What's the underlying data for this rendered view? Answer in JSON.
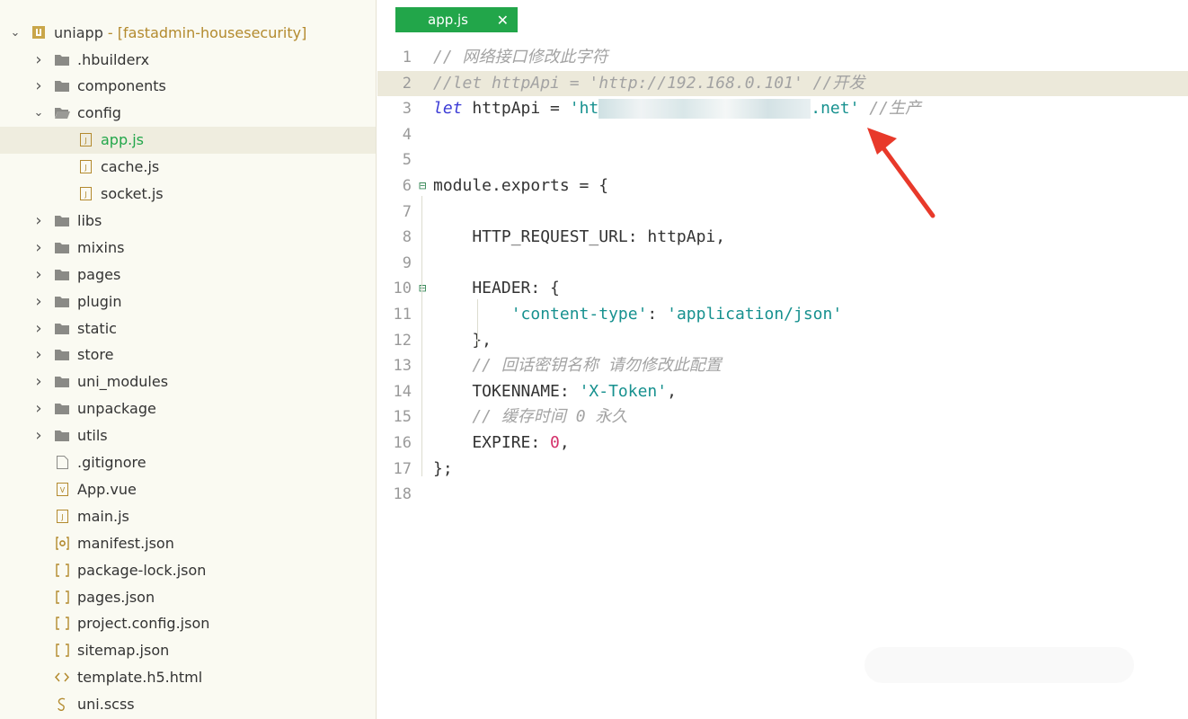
{
  "sidebar": {
    "project": {
      "name": "uniapp",
      "suffix": " - [fastadmin-housesecurity]"
    },
    "items": [
      {
        "label": ".hbuilderx",
        "type": "folder",
        "indent": 1,
        "expanded": false
      },
      {
        "label": "components",
        "type": "folder",
        "indent": 1,
        "expanded": false
      },
      {
        "label": "config",
        "type": "folder-open",
        "indent": 1,
        "expanded": true
      },
      {
        "label": "app.js",
        "type": "js",
        "indent": 2,
        "selected": true
      },
      {
        "label": "cache.js",
        "type": "js",
        "indent": 2
      },
      {
        "label": "socket.js",
        "type": "js",
        "indent": 2
      },
      {
        "label": "libs",
        "type": "folder",
        "indent": 1,
        "expanded": false
      },
      {
        "label": "mixins",
        "type": "folder",
        "indent": 1,
        "expanded": false
      },
      {
        "label": "pages",
        "type": "folder",
        "indent": 1,
        "expanded": false
      },
      {
        "label": "plugin",
        "type": "folder",
        "indent": 1,
        "expanded": false
      },
      {
        "label": "static",
        "type": "folder",
        "indent": 1,
        "expanded": false
      },
      {
        "label": "store",
        "type": "folder",
        "indent": 1,
        "expanded": false
      },
      {
        "label": "uni_modules",
        "type": "folder",
        "indent": 1,
        "expanded": false
      },
      {
        "label": "unpackage",
        "type": "folder",
        "indent": 1,
        "expanded": false
      },
      {
        "label": "utils",
        "type": "folder",
        "indent": 1,
        "expanded": false
      },
      {
        "label": ".gitignore",
        "type": "file",
        "indent": 1
      },
      {
        "label": "App.vue",
        "type": "vue",
        "indent": 1
      },
      {
        "label": "main.js",
        "type": "js",
        "indent": 1
      },
      {
        "label": "manifest.json",
        "type": "manifest",
        "indent": 1
      },
      {
        "label": "package-lock.json",
        "type": "json",
        "indent": 1
      },
      {
        "label": "pages.json",
        "type": "json",
        "indent": 1
      },
      {
        "label": "project.config.json",
        "type": "json",
        "indent": 1
      },
      {
        "label": "sitemap.json",
        "type": "json",
        "indent": 1
      },
      {
        "label": "template.h5.html",
        "type": "html",
        "indent": 1
      },
      {
        "label": "uni.scss",
        "type": "scss",
        "indent": 1
      }
    ]
  },
  "editor": {
    "tab": {
      "label": "app.js",
      "close": "✕"
    },
    "lines": [
      {
        "n": "1",
        "parts": [
          {
            "c": "cm",
            "t": "// 网络接口修改此字符"
          }
        ]
      },
      {
        "n": "2",
        "hl": true,
        "parts": [
          {
            "c": "cm",
            "t": "//let httpApi = 'http://192.168.0.101' //开发"
          }
        ]
      },
      {
        "n": "3",
        "parts": [
          {
            "c": "kw",
            "t": "let"
          },
          {
            "c": "",
            "t": " httpApi = "
          },
          {
            "c": "str",
            "t": "'ht"
          },
          {
            "c": "blur",
            "t": ""
          },
          {
            "c": "str",
            "t": ".net'"
          },
          {
            "c": "cm",
            "t": " //生产"
          }
        ]
      },
      {
        "n": "4",
        "parts": []
      },
      {
        "n": "5",
        "parts": []
      },
      {
        "n": "6",
        "fold": "⊟",
        "parts": [
          {
            "c": "",
            "t": "module.exports = {"
          }
        ]
      },
      {
        "n": "7",
        "parts": []
      },
      {
        "n": "8",
        "parts": [
          {
            "c": "",
            "t": "    HTTP_REQUEST_URL: httpApi,"
          }
        ]
      },
      {
        "n": "9",
        "parts": []
      },
      {
        "n": "10",
        "fold": "⊟",
        "parts": [
          {
            "c": "",
            "t": "    HEADER: {"
          }
        ]
      },
      {
        "n": "11",
        "parts": [
          {
            "c": "",
            "t": "        "
          },
          {
            "c": "str",
            "t": "'content-type'"
          },
          {
            "c": "",
            "t": ": "
          },
          {
            "c": "str",
            "t": "'application/json'"
          }
        ]
      },
      {
        "n": "12",
        "parts": [
          {
            "c": "",
            "t": "    },"
          }
        ]
      },
      {
        "n": "13",
        "parts": [
          {
            "c": "cm",
            "t": "    // 回话密钥名称 请勿修改此配置"
          }
        ]
      },
      {
        "n": "14",
        "parts": [
          {
            "c": "",
            "t": "    TOKENNAME: "
          },
          {
            "c": "str",
            "t": "'X-Token'"
          },
          {
            "c": "",
            "t": ","
          }
        ]
      },
      {
        "n": "15",
        "parts": [
          {
            "c": "cm",
            "t": "    // 缓存时间 0 永久"
          }
        ]
      },
      {
        "n": "16",
        "parts": [
          {
            "c": "",
            "t": "    EXPIRE: "
          },
          {
            "c": "num",
            "t": "0"
          },
          {
            "c": "",
            "t": ","
          }
        ]
      },
      {
        "n": "17",
        "parts": [
          {
            "c": "",
            "t": "};"
          }
        ]
      },
      {
        "n": "18",
        "parts": []
      }
    ]
  },
  "colors": {
    "accent": "#22a64a",
    "annotation_arrow": "#e8392a"
  }
}
